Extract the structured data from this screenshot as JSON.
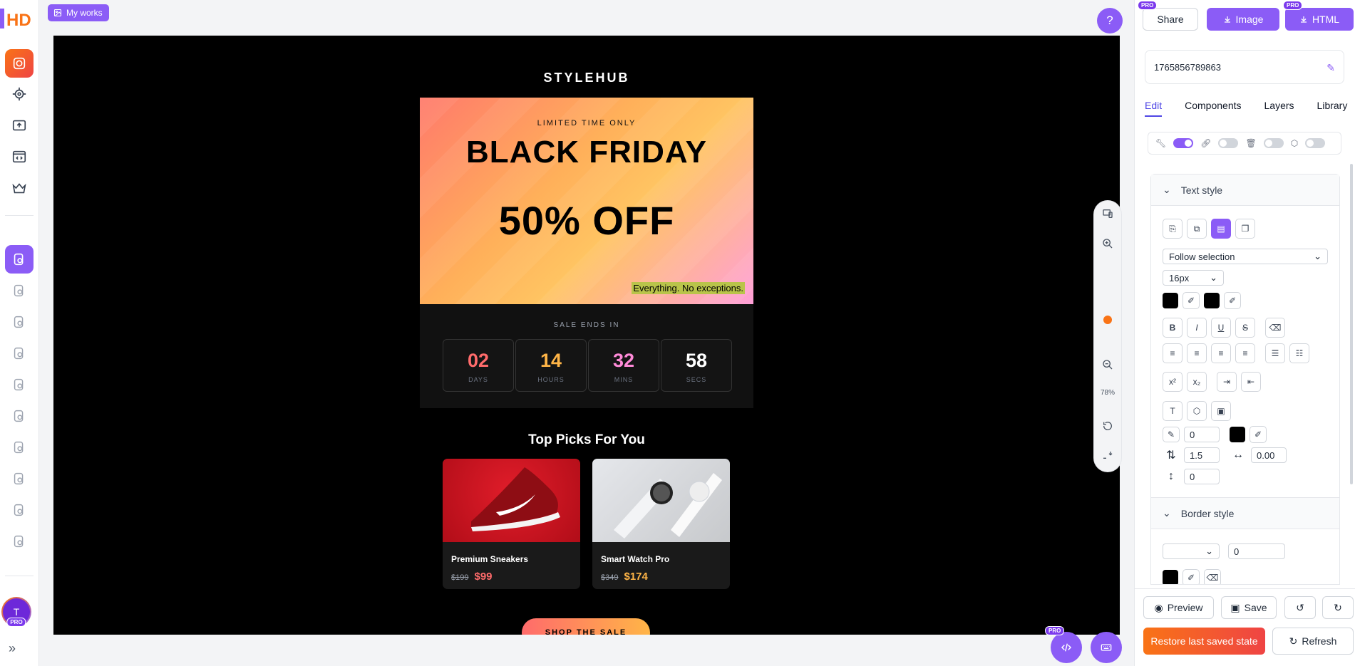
{
  "app": {
    "logo_text": "HD",
    "my_works_label": "My works",
    "help_symbol": "?"
  },
  "rail": {
    "items": [
      "design-icon",
      "target-icon",
      "upload-icon",
      "code-window-icon",
      "crown-icon"
    ],
    "history_count": 10,
    "avatar_initial": "T",
    "avatar_badge": "PRO",
    "expand_symbol": "»"
  },
  "email": {
    "brand": "STYLEHUB",
    "hero": {
      "eyebrow": "LIMITED TIME ONLY",
      "title": "BLACK FRIDAY",
      "discount": "50% OFF",
      "tagline": "Everything. No exceptions."
    },
    "countdown": {
      "label": "SALE ENDS IN",
      "units": [
        {
          "value": "02",
          "label": "DAYS",
          "color": "#ff6b6b"
        },
        {
          "value": "14",
          "label": "HOURS",
          "color": "#ffb547"
        },
        {
          "value": "32",
          "label": "MINS",
          "color": "#ff8ad8"
        },
        {
          "value": "58",
          "label": "SECS",
          "color": "#ffffff"
        }
      ]
    },
    "picks_title": "Top Picks For You",
    "products": [
      {
        "name": "Premium Sneakers",
        "old_price": "$199",
        "price": "$99",
        "price_color": "#ff6b6b"
      },
      {
        "name": "Smart Watch Pro",
        "old_price": "$349",
        "price": "$174",
        "price_color": "#ffb547"
      }
    ],
    "cta": "SHOP THE SALE"
  },
  "zoom": {
    "percent": "78%"
  },
  "panel": {
    "share": "Share",
    "image": "Image",
    "html": "HTML",
    "pro": "PRO",
    "doc_id": "1765856789863",
    "tabs": [
      "Edit",
      "Components",
      "Layers",
      "Library"
    ],
    "active_tab": "Edit",
    "text_style": {
      "title": "Text style",
      "font_select": "Follow selection",
      "font_size": "16px",
      "stroke_width": "0",
      "line_height": "1.5",
      "letter_spacing": "0.00",
      "paragraph_spacing": "0"
    },
    "border_style": {
      "title": "Border style",
      "width": "0"
    },
    "preview": "Preview",
    "save": "Save",
    "restore": "Restore last saved state",
    "refresh": "Refresh"
  },
  "colors": {
    "accent": "#8b5cf6",
    "orange": "#f97316",
    "red": "#ef4444"
  }
}
